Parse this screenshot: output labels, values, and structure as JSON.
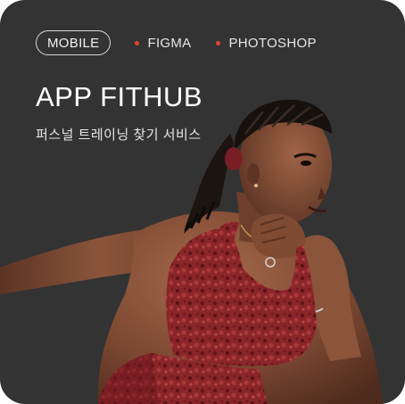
{
  "tags": {
    "primary": "MOBILE",
    "items": [
      "FIGMA",
      "PHOTOSHOP"
    ]
  },
  "title": "APP FITHUB",
  "subtitle": "퍼스널 트레이닝 찾기 서비스",
  "colors": {
    "background": "#333333",
    "accent_dot": "#e2452b",
    "outfit": "#8e2a2c"
  },
  "image": {
    "icon": "athlete-photo"
  }
}
